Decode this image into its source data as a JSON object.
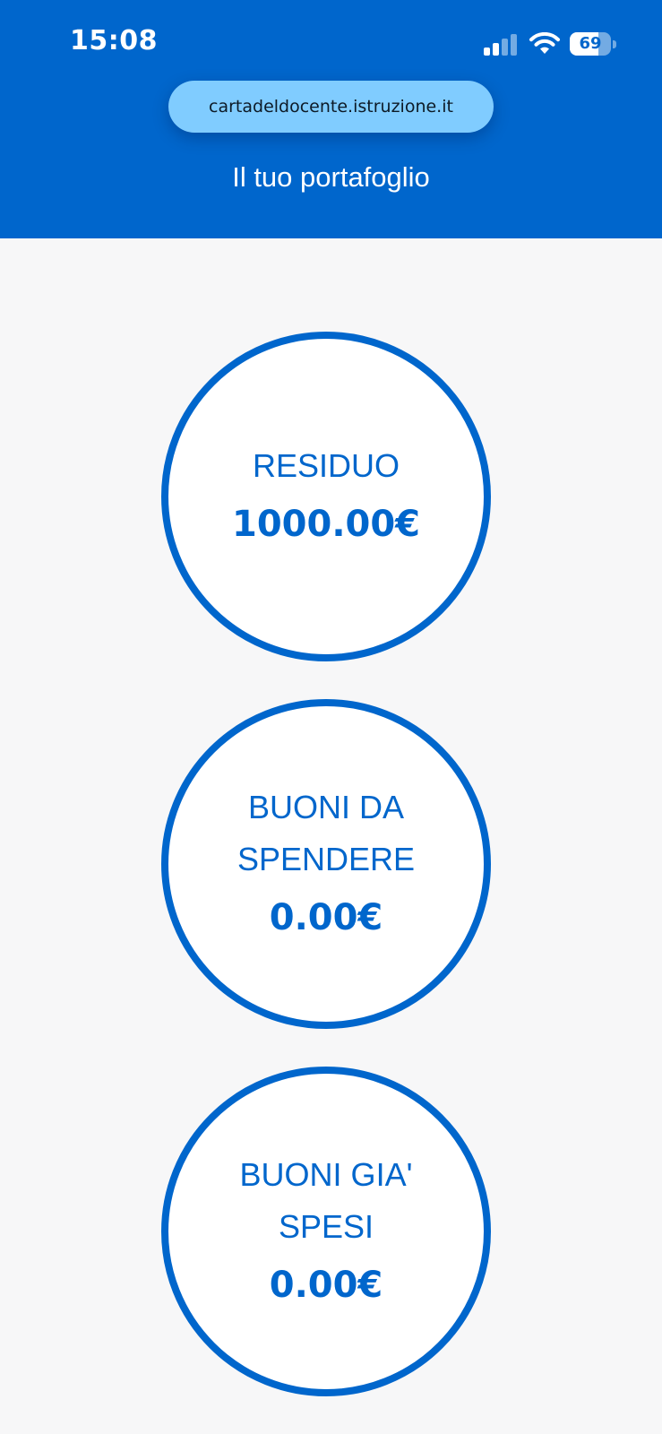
{
  "status_bar": {
    "time": "15:08",
    "battery_level": 69,
    "battery_text": "69"
  },
  "browser": {
    "url": "cartadeldocente.istruzione.it"
  },
  "header": {
    "title": "Il tuo portafoglio",
    "background_color": "#0066cc"
  },
  "wallet": {
    "accent_color": "#0066cc",
    "items": [
      {
        "label": "RESIDUO",
        "value": "1000.00€"
      },
      {
        "label": "BUONI DA SPENDERE",
        "value": "0.00€"
      },
      {
        "label": "BUONI GIA' SPESI",
        "value": "0.00€"
      }
    ]
  },
  "icons": {
    "signal": "cellular-signal-icon",
    "wifi": "wifi-icon",
    "battery": "battery-icon"
  }
}
